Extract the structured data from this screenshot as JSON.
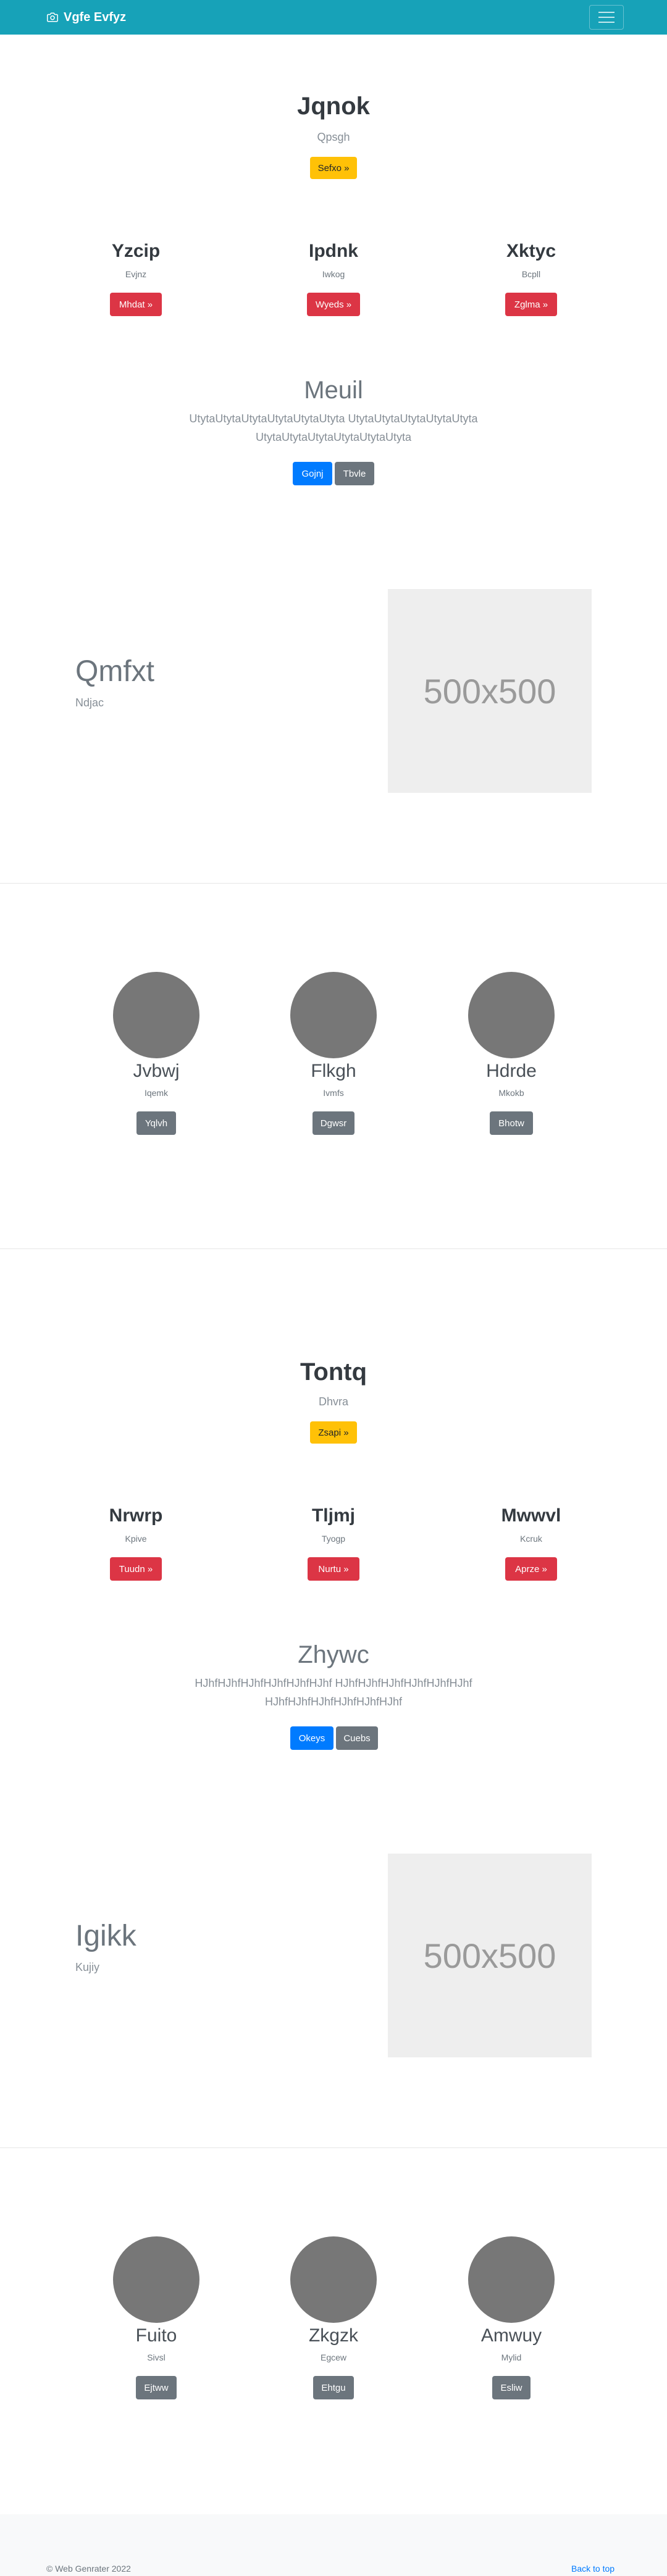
{
  "navbar": {
    "brand": "Vgfe Evfyz",
    "brand_icon": "camera-icon",
    "toggler_icon": "hamburger-icon"
  },
  "section1": {
    "title": "Jqnok",
    "subtitle": "Qpsgh",
    "button": "Sefxo »"
  },
  "features1": [
    {
      "title": "Yzcip",
      "subtitle": "Evjnz",
      "button": "Mhdat »"
    },
    {
      "title": "Ipdnk",
      "subtitle": "Iwkog",
      "button": "Wyeds »"
    },
    {
      "title": "Xktyc",
      "subtitle": "Bcpll",
      "button": "Zglma »"
    }
  ],
  "meuil": {
    "title": "Meuil",
    "text_line1": "UtytaUtytaUtytaUtytaUtytaUtyta UtytaUtytaUtytaUtytaUtyta",
    "text_line2": "UtytaUtytaUtytaUtytaUtytaUtyta",
    "button_primary": "Gojnj",
    "button_secondary": "Tbvle"
  },
  "hero1": {
    "title": "Qmfxt",
    "subtitle": "Ndjac",
    "image_label": "500x500"
  },
  "team1": [
    {
      "name": "Jvbwj",
      "role": "Iqemk",
      "button": "Yqlvh"
    },
    {
      "name": "Flkgh",
      "role": "Ivmfs",
      "button": "Dgwsr"
    },
    {
      "name": "Hdrde",
      "role": "Mkokb",
      "button": "Bhotw"
    }
  ],
  "section2": {
    "title": "Tontq",
    "subtitle": "Dhvra",
    "button": "Zsapi »"
  },
  "features2": [
    {
      "title": "Nrwrp",
      "subtitle": "Kpive",
      "button": "Tuudn »"
    },
    {
      "title": "Tljmj",
      "subtitle": "Tyogp",
      "button": "Nurtu »"
    },
    {
      "title": "Mwwvl",
      "subtitle": "Kcruk",
      "button": "Aprze »"
    }
  ],
  "zhywc": {
    "title": "Zhywc",
    "text_line1": "HJhfHJhfHJhfHJhfHJhfHJhf HJhfHJhfHJhfHJhfHJhfHJhf",
    "text_line2": "HJhfHJhfHJhfHJhfHJhfHJhf",
    "button_primary": "Okeys",
    "button_secondary": "Cuebs"
  },
  "hero2": {
    "title": "Igikk",
    "subtitle": "Kujiy",
    "image_label": "500x500"
  },
  "team2": [
    {
      "name": "Fuito",
      "role": "Sivsl",
      "button": "Ejtww"
    },
    {
      "name": "Zkgzk",
      "role": "Egcew",
      "button": "Ehtgu"
    },
    {
      "name": "Amwuy",
      "role": "Mylid",
      "button": "Esliw"
    }
  ],
  "footer": {
    "copyright": "© Web Genrater 2022",
    "back_to_top": "Back to top"
  }
}
